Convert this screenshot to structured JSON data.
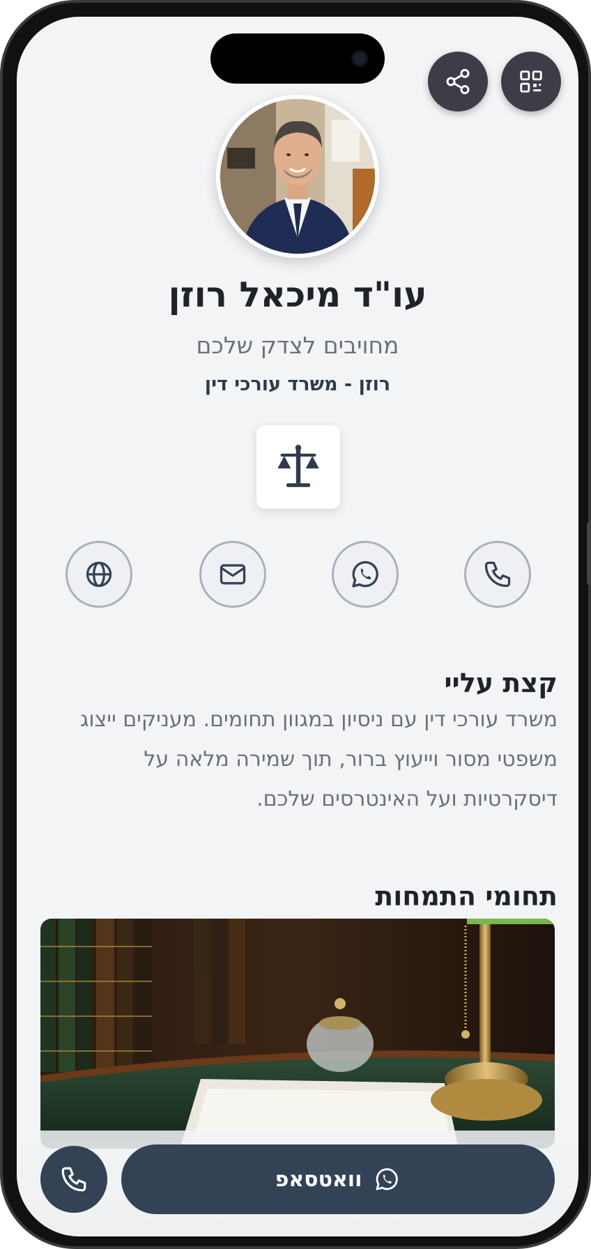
{
  "profile": {
    "name": "עו\"ד מיכאל רוזן",
    "tagline": "מחויבים לצדק שלכם",
    "company": "רוזן - משרד עורכי דין"
  },
  "about": {
    "title": "קצת עליי",
    "text": "משרד עורכי דין עם ניסיון במגוון תחומים. מעניקים ייצוג משפטי מסור וייעוץ ברור, תוך שמירה מלאה על דיסקרטיות ועל האינטרסים שלכם."
  },
  "specialties": {
    "title": "תחומי התמחות"
  },
  "actions": {
    "whatsapp_label": "וואטסאפ"
  },
  "icons": {
    "share": "share-icon",
    "qr": "qr-code-icon",
    "logo": "scales-of-justice-icon",
    "phone": "phone-icon",
    "whatsapp": "whatsapp-icon",
    "email": "mail-icon",
    "website": "globe-icon"
  },
  "colors": {
    "primary": "#344256",
    "background": "#f2f4f6",
    "text_dark": "#1f2328",
    "text_muted": "#6b7077"
  }
}
